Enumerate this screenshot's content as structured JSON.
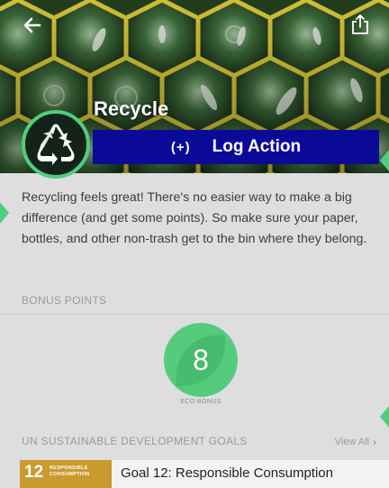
{
  "header": {
    "title": "Recycle",
    "back_icon": "back-arrow-icon",
    "share_icon": "share-icon"
  },
  "hero": {
    "badge_icon": "recycle-icon"
  },
  "log_action": {
    "icon_text": "(+)",
    "label": "Log Action"
  },
  "description": "Recycling feels great! There's no easier way to make a big difference (and get some points). So make sure your paper, bottles, and other non-trash get to the bin where they belong.",
  "bonus": {
    "section_label": "BONUS POINTS",
    "eco_value": "8",
    "eco_label": "ECO BONUS"
  },
  "goals": {
    "section_label": "UN SUSTAINABLE DEVELOPMENT GOALS",
    "view_all": "View All",
    "view_all_icon": "chevron-right-icon",
    "items": [
      {
        "number": "12",
        "tile_line1": "RESPONSIBLE",
        "tile_line2": "CONSUMPTION",
        "title": "Goal 12: Responsible Consumption"
      }
    ]
  },
  "colors": {
    "log_button": "#0b0a98",
    "accent_green": "#55cc7d",
    "goal_tile": "#c99a2e",
    "background": "#dedede"
  }
}
